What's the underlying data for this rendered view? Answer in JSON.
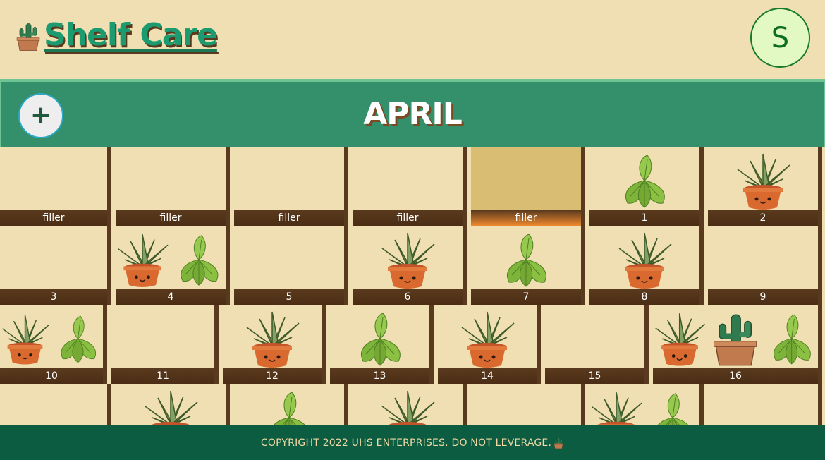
{
  "header": {
    "brand": "Shelf Care",
    "avatar_initial": "S",
    "logo_icon": "potted-cactus-icon"
  },
  "month_bar": {
    "add_label": "+",
    "month": "APRIL"
  },
  "calendar": {
    "rows": [
      {
        "cells": [
          {
            "label": "filler",
            "plants": []
          },
          {
            "label": "filler",
            "plants": []
          },
          {
            "label": "filler",
            "plants": []
          },
          {
            "label": "filler",
            "plants": []
          },
          {
            "label": "filler",
            "plants": [],
            "today": true
          },
          {
            "label": "1",
            "plants": [
              "basil"
            ]
          },
          {
            "label": "2",
            "plants": [
              "succulent"
            ]
          }
        ]
      },
      {
        "cells": [
          {
            "label": "3",
            "plants": []
          },
          {
            "label": "4",
            "plants": [
              "succulent",
              "basil"
            ]
          },
          {
            "label": "5",
            "plants": []
          },
          {
            "label": "6",
            "plants": [
              "succulent"
            ]
          },
          {
            "label": "7",
            "plants": [
              "basil"
            ]
          },
          {
            "label": "8",
            "plants": [
              "succulent"
            ]
          },
          {
            "label": "9",
            "plants": []
          }
        ]
      },
      {
        "cells": [
          {
            "label": "10",
            "plants": [
              "succulent",
              "basil"
            ]
          },
          {
            "label": "11",
            "plants": []
          },
          {
            "label": "12",
            "plants": [
              "succulent"
            ]
          },
          {
            "label": "13",
            "plants": [
              "basil"
            ]
          },
          {
            "label": "14",
            "plants": [
              "succulent"
            ]
          },
          {
            "label": "15",
            "plants": []
          },
          {
            "label": "16",
            "plants": [
              "succulent",
              "cactus",
              "basil"
            ]
          }
        ]
      },
      {
        "cells": [
          {
            "label": "",
            "plants": []
          },
          {
            "label": "",
            "plants": [
              "succulent"
            ]
          },
          {
            "label": "",
            "plants": [
              "basil"
            ]
          },
          {
            "label": "",
            "plants": [
              "succulent"
            ]
          },
          {
            "label": "",
            "plants": []
          },
          {
            "label": "",
            "plants": [
              "succulent",
              "basil"
            ]
          },
          {
            "label": "",
            "plants": []
          }
        ]
      }
    ]
  },
  "footer": {
    "text": "COPYRIGHT 2022 UHS ENTERPRISES. DO NOT LEVERAGE.",
    "icon": "potted-cactus-icon"
  },
  "colors": {
    "background": "#efdfb2",
    "brand_green": "#1b9b6f",
    "month_bar": "#33906a",
    "cell_border": "#5a3a1e",
    "today_highlight": "#d9bd73",
    "footer": "#0b5c40"
  }
}
